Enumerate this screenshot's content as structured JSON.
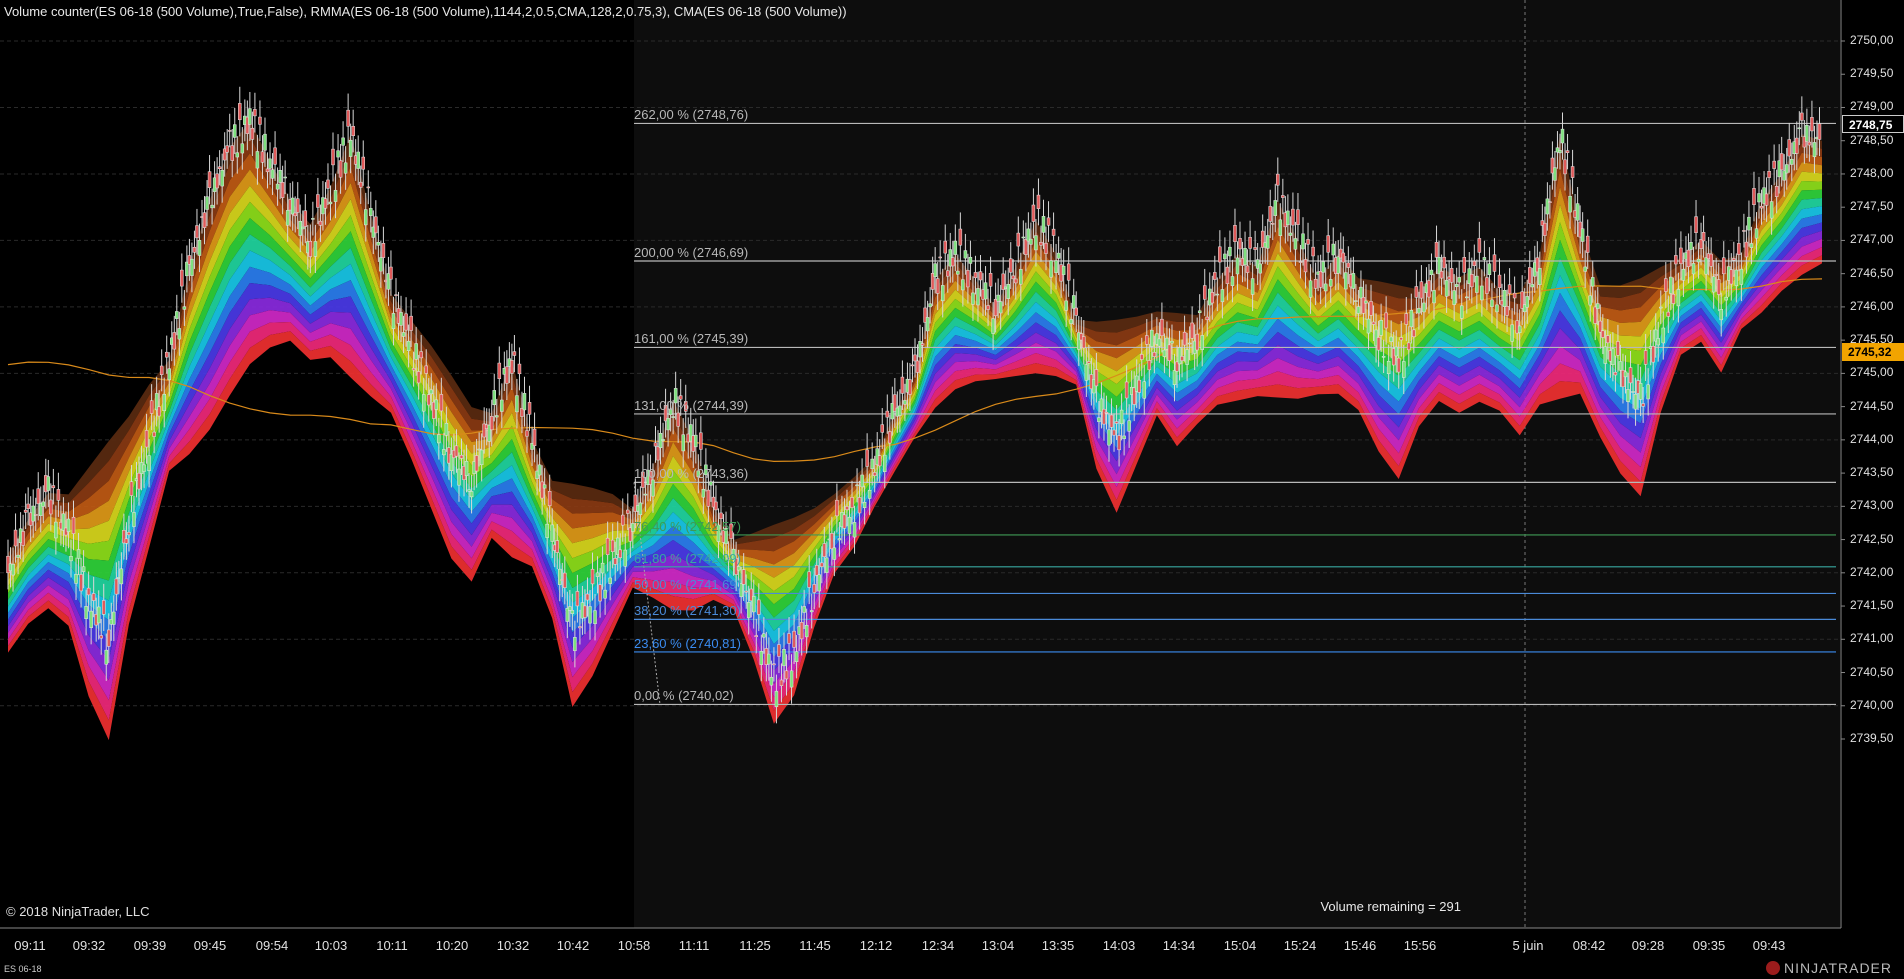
{
  "chart_data": {
    "type": "candlestick",
    "header": "Volume counter(ES 06-18 (500 Volume),True,False), RMMA(ES 06-18 (500 Volume),1144,2,0.5,CMA,128,2,0.75,3), CMA(ES 06-18 (500 Volume))",
    "instrument": "ES 06-18",
    "copyright": "© 2018 NinjaTrader, LLC",
    "volume_remaining": "Volume remaining = 291",
    "brand": "NINJATRADER",
    "ylim": [
      2739.5,
      2750.0
    ],
    "y_ticks": [
      "2750,00",
      "2749,50",
      "2749,00",
      "2748,50",
      "2748,00",
      "2747,50",
      "2747,00",
      "2746,50",
      "2746,00",
      "2745,50",
      "2745,00",
      "2744,50",
      "2744,00",
      "2743,50",
      "2743,00",
      "2742,50",
      "2742,00",
      "2741,50",
      "2741,00",
      "2740,50",
      "2740,00",
      "2739,50"
    ],
    "x_ticks": [
      "09:11",
      "09:32",
      "09:39",
      "09:45",
      "09:54",
      "10:03",
      "10:11",
      "10:20",
      "10:32",
      "10:42",
      "10:58",
      "11:11",
      "11:25",
      "11:45",
      "12:12",
      "12:34",
      "13:04",
      "13:35",
      "14:03",
      "14:34",
      "15:04",
      "15:24",
      "15:46",
      "15:56",
      "5 juin",
      "08:42",
      "09:28",
      "09:35",
      "09:43"
    ],
    "last_price": "2748,75",
    "cma_price": "2745,32",
    "fib_levels": [
      {
        "label": "262,00 % (2748,76)",
        "price": 2748.76,
        "color": "#b8b8b8"
      },
      {
        "label": "200,00 % (2746,69)",
        "price": 2746.69,
        "color": "#b8b8b8"
      },
      {
        "label": "161,00 % (2745,39)",
        "price": 2745.39,
        "color": "#b8b8b8"
      },
      {
        "label": "131,00 % (2744,39)",
        "price": 2744.39,
        "color": "#b8b8b8"
      },
      {
        "label": "100,00 % (2743,36)",
        "price": 2743.36,
        "color": "#b8b8b8"
      },
      {
        "label": "76,40 % (2742,57)",
        "price": 2742.57,
        "color": "#3f9a55"
      },
      {
        "label": "61,80 % (2742,09)",
        "price": 2742.09,
        "color": "#38a8a0"
      },
      {
        "label": "50,00 % (2741,69)",
        "price": 2741.69,
        "color": "#4a8ad8"
      },
      {
        "label": "38,20 % (2741,30)",
        "price": 2741.3,
        "color": "#4a8ad8"
      },
      {
        "label": "23,60 % (2740,81)",
        "price": 2740.81,
        "color": "#3b8cf0"
      },
      {
        "label": "0,00 % (2740,02)",
        "price": 2740.02,
        "color": "#b8b8b8"
      }
    ],
    "price_series": [
      2742.0,
      2742.8,
      2743.2,
      2742.6,
      2741.6,
      2741.0,
      2742.8,
      2744.0,
      2745.2,
      2746.6,
      2747.6,
      2748.4,
      2748.8,
      2748.2,
      2747.6,
      2747.0,
      2747.8,
      2748.6,
      2747.4,
      2746.2,
      2745.4,
      2744.6,
      2743.8,
      2743.4,
      2744.4,
      2745.2,
      2744.0,
      2742.6,
      2741.2,
      2741.6,
      2742.2,
      2742.8,
      2743.6,
      2744.6,
      2744.0,
      2743.0,
      2742.2,
      2741.4,
      2740.4,
      2740.8,
      2741.8,
      2742.6,
      2743.0,
      2743.6,
      2744.4,
      2745.0,
      2746.4,
      2746.8,
      2746.4,
      2746.0,
      2746.6,
      2747.3,
      2746.8,
      2745.8,
      2744.6,
      2744.0,
      2744.8,
      2745.6,
      2745.2,
      2745.6,
      2746.4,
      2746.8,
      2746.6,
      2747.6,
      2747.0,
      2746.4,
      2746.8,
      2746.2,
      2745.6,
      2745.2,
      2746.0,
      2746.6,
      2746.2,
      2746.6,
      2746.2,
      2745.8,
      2746.8,
      2748.6,
      2747.2,
      2745.6,
      2745.0,
      2744.6,
      2745.8,
      2746.6,
      2747.0,
      2746.2,
      2746.8,
      2747.6,
      2748.0,
      2748.6,
      2748.5
    ]
  }
}
